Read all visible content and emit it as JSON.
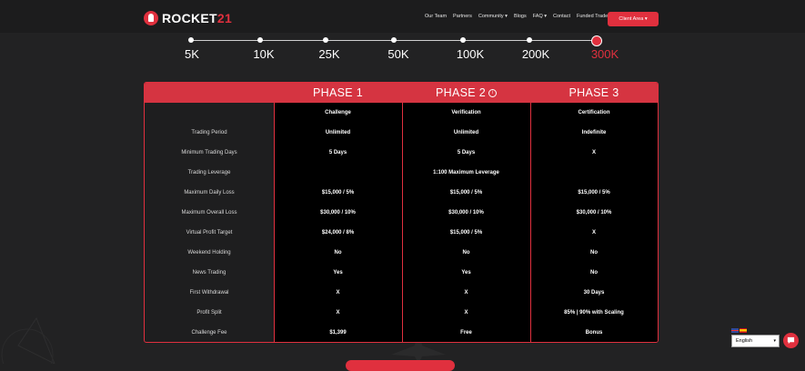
{
  "header": {
    "logo_prefix": "ROCKET",
    "logo_suffix": "21",
    "nav": [
      "Our Team",
      "Partners",
      "Community ▾",
      "Blogs",
      "FAQ ▾",
      "Contact",
      "Funded Traders"
    ],
    "client_area": "Client Area ▾"
  },
  "slider": {
    "options": [
      "5K",
      "10K",
      "25K",
      "50K",
      "100K",
      "200K",
      "300K"
    ],
    "selected": "300K"
  },
  "table": {
    "phases": [
      "PHASE 1",
      "PHASE 2",
      "PHASE 3"
    ],
    "rows": [
      {
        "label": "",
        "values": [
          "Challenge",
          "Verification",
          "Certification"
        ]
      },
      {
        "label": "Trading Period",
        "values": [
          "Unlimited",
          "Unlimited",
          "Indefinite"
        ]
      },
      {
        "label": "Minimum Trading Days",
        "values": [
          "5 Days",
          "5 Days",
          "X"
        ]
      },
      {
        "label": "Trading Leverage",
        "merged": "1:100 Maximum Leverage"
      },
      {
        "label": "Maximum Daily Loss",
        "values": [
          "$15,000 / 5%",
          "$15,000 / 5%",
          "$15,000 / 5%"
        ]
      },
      {
        "label": "Maximum Overall Loss",
        "values": [
          "$30,000 / 10%",
          "$30,000 / 10%",
          "$30,000 / 10%"
        ]
      },
      {
        "label": "Virtual Profit Target",
        "values": [
          "$24,000 / 8%",
          "$15,000 / 5%",
          "X"
        ]
      },
      {
        "label": "Weekend Holding",
        "values": [
          "No",
          "No",
          "No"
        ]
      },
      {
        "label": "News Trading",
        "values": [
          "Yes",
          "Yes",
          "No"
        ]
      },
      {
        "label": "First Withdrawal",
        "values": [
          "X",
          "X",
          "30 Days"
        ]
      },
      {
        "label": "Profit Split",
        "values": [
          "X",
          "X",
          "85% | 90% with Scaling"
        ]
      },
      {
        "label": "Challenge Fee",
        "values": [
          "$1,399",
          "Free",
          "Bonus"
        ]
      }
    ]
  },
  "language": {
    "selected": "English"
  },
  "colors": {
    "accent": "#e0303e",
    "background": "#222223",
    "table_black": "#000000"
  }
}
